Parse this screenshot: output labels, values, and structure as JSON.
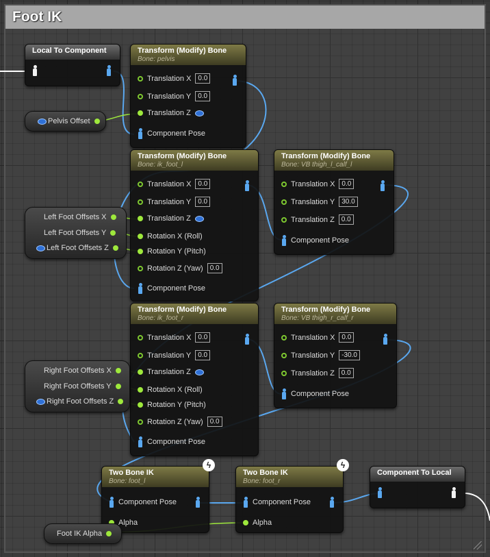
{
  "comment": {
    "title": "Foot IK"
  },
  "colors": {
    "exec_wire": "#ffffff",
    "pose_wire": "#5aa8f0",
    "float_wire": "#9ee83c",
    "pin": "#9ee83c",
    "header_modify": "#7e7a46",
    "header_plain": "#6b6b6b"
  },
  "local_to_component": {
    "title": "Local To Component"
  },
  "component_to_local": {
    "title": "Component To Local"
  },
  "pelvis": {
    "title": "Transform (Modify) Bone",
    "subtitle": "Bone: pelvis",
    "tx_label": "Translation X",
    "tx": "0.0",
    "ty_label": "Translation Y",
    "ty": "0.0",
    "tz_label": "Translation Z",
    "pose_label": "Component Pose"
  },
  "pelvis_offset": {
    "label": "Pelvis Offset"
  },
  "ik_foot_l": {
    "title": "Transform (Modify) Bone",
    "subtitle": "Bone: ik_foot_l",
    "tx_label": "Translation X",
    "tx": "0.0",
    "ty_label": "Translation Y",
    "ty": "0.0",
    "tz_label": "Translation Z",
    "rx_label": "Rotation X (Roll)",
    "ry_label": "Rotation Y (Pitch)",
    "rz_label": "Rotation Z (Yaw)",
    "rz": "0.0",
    "pose_label": "Component Pose"
  },
  "thigh_l": {
    "title": "Transform (Modify) Bone",
    "subtitle": "Bone: VB thigh_l_calf_l",
    "tx_label": "Translation X",
    "tx": "0.0",
    "ty_label": "Translation Y",
    "ty": "30.0",
    "tz_label": "Translation Z",
    "tz": "0.0",
    "pose_label": "Component Pose"
  },
  "left_offsets": {
    "x": "Left Foot Offsets X",
    "y": "Left Foot Offsets Y",
    "z": "Left Foot Offsets Z"
  },
  "ik_foot_r": {
    "title": "Transform (Modify) Bone",
    "subtitle": "Bone: ik_foot_r",
    "tx_label": "Translation X",
    "tx": "0.0",
    "ty_label": "Translation Y",
    "ty": "0.0",
    "tz_label": "Translation Z",
    "rx_label": "Rotation X (Roll)",
    "ry_label": "Rotation Y (Pitch)",
    "rz_label": "Rotation Z (Yaw)",
    "rz": "0.0",
    "pose_label": "Component Pose"
  },
  "thigh_r": {
    "title": "Transform (Modify) Bone",
    "subtitle": "Bone: VB thigh_r_calf_r",
    "tx_label": "Translation X",
    "tx": "0.0",
    "ty_label": "Translation Y",
    "ty": "-30.0",
    "tz_label": "Translation Z",
    "tz": "0.0",
    "pose_label": "Component Pose"
  },
  "right_offsets": {
    "x": "Right Foot Offsets X",
    "y": "Right Foot Offsets Y",
    "z": "Right Foot Offsets Z"
  },
  "two_bone_l": {
    "title": "Two Bone IK",
    "subtitle": "Bone: foot_l",
    "pose_label": "Component Pose",
    "alpha_label": "Alpha"
  },
  "two_bone_r": {
    "title": "Two Bone IK",
    "subtitle": "Bone: foot_r",
    "pose_label": "Component Pose",
    "alpha_label": "Alpha"
  },
  "foot_ik_alpha": {
    "label": "Foot IK Alpha"
  },
  "icons": {
    "pose": "mannequin-icon",
    "vector": "vector-icon",
    "fast_path": "lightning-icon",
    "resize": "resize-grip-icon"
  }
}
